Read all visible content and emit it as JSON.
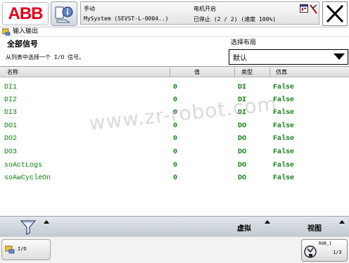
{
  "status_bar": {
    "logo_text": "ABB",
    "mode": "手动",
    "system": "MySystem (SEVST-L-0004..)",
    "motor_state": "电机开启",
    "run_state": "已停止 (2 / 2) (速度 100%)",
    "icons": [
      "abb-logo",
      "menu-icon",
      "program-window-icon",
      "stop-status-icon",
      "close-icon"
    ]
  },
  "app": {
    "title": "输入输出",
    "icon": "io-app-icon"
  },
  "filter": {
    "title": "全部信号",
    "instruction": "从列表中选择一个 I/O 信号。",
    "layout_label": "选择布局",
    "layout_value": "默认"
  },
  "table": {
    "columns": [
      "名称",
      "值",
      "类型",
      "仿真"
    ],
    "rows": [
      {
        "name": "DI1",
        "value": "0",
        "type": "DI",
        "simulated": "False"
      },
      {
        "name": "DI2",
        "value": "0",
        "type": "DI",
        "simulated": "False"
      },
      {
        "name": "DI3",
        "value": "0",
        "type": "DI",
        "simulated": "False"
      },
      {
        "name": "DO1",
        "value": "0",
        "type": "DO",
        "simulated": "False"
      },
      {
        "name": "DO2",
        "value": "0",
        "type": "DO",
        "simulated": "False"
      },
      {
        "name": "DO3",
        "value": "0",
        "type": "DO",
        "simulated": "False"
      },
      {
        "name": "soActLogs",
        "value": "0",
        "type": "DO",
        "simulated": "False"
      },
      {
        "name": "soAwCycleOn",
        "value": "0",
        "type": "DO",
        "simulated": "False"
      }
    ]
  },
  "watermark": "www.zr-robot.com",
  "command_bar": {
    "virtual_label": "虚拟",
    "view_label": "视图"
  },
  "taskbar": {
    "io_label": "I/O",
    "rob_label": "ROB_1",
    "rob_speed": "1/3"
  },
  "colors": {
    "brand": "#e2001a",
    "signal_text": "#0c7f0c"
  }
}
